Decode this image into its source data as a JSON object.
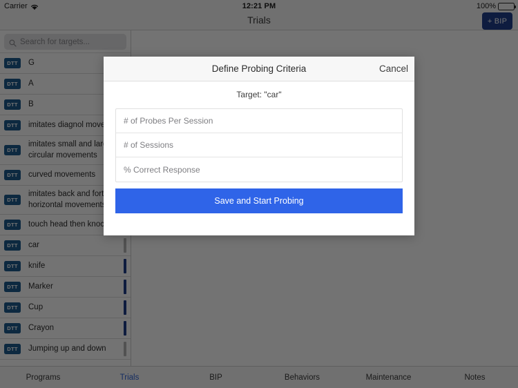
{
  "status_bar": {
    "carrier": "Carrier",
    "wifi_icon": "wifi-icon",
    "time": "12:21 PM",
    "battery_percent": "100%",
    "battery_icon": "battery-icon"
  },
  "nav_bar": {
    "title": "Trials",
    "bip_button_label": "+ BIP"
  },
  "sidebar": {
    "search": {
      "placeholder": "Search for targets...",
      "value": "",
      "icon": "search-icon"
    },
    "targets": [
      {
        "badge": "DTT",
        "label": "G",
        "accent": "none"
      },
      {
        "badge": "DTT",
        "label": "A",
        "accent": "none"
      },
      {
        "badge": "DTT",
        "label": "B",
        "accent": "none"
      },
      {
        "badge": "DTT",
        "label": "imitates diagnol movem",
        "accent": "none"
      },
      {
        "badge": "DTT",
        "label": "imitates small and large\ncircular movements",
        "accent": "none"
      },
      {
        "badge": "DTT",
        "label": "curved movements",
        "accent": "none"
      },
      {
        "badge": "DTT",
        "label": "imitates back and forth\nhorizontal movements",
        "accent": "none"
      },
      {
        "badge": "DTT",
        "label": "touch head then knock",
        "accent": "none"
      },
      {
        "badge": "DTT",
        "label": "car",
        "accent": "muted"
      },
      {
        "badge": "DTT",
        "label": "knife",
        "accent": "blue"
      },
      {
        "badge": "DTT",
        "label": "Marker",
        "accent": "blue"
      },
      {
        "badge": "DTT",
        "label": "Cup",
        "accent": "blue"
      },
      {
        "badge": "DTT",
        "label": "Crayon",
        "accent": "blue"
      },
      {
        "badge": "DTT",
        "label": "Jumping up and down",
        "accent": "muted"
      }
    ]
  },
  "modal": {
    "title": "Define Probing Criteria",
    "cancel_label": "Cancel",
    "subtitle": "Target: \"car\"",
    "fields": [
      {
        "placeholder": "# of Probes Per Session",
        "value": ""
      },
      {
        "placeholder": "# of Sessions",
        "value": ""
      },
      {
        "placeholder": "% Correct Response",
        "value": ""
      }
    ],
    "primary_button_label": "Save and Start Probing",
    "primary_button_color": "#2f64e8"
  },
  "tab_bar": {
    "active_color": "#2f64d8",
    "tabs": [
      {
        "label": "Programs",
        "active": false
      },
      {
        "label": "Trials",
        "active": true
      },
      {
        "label": "BIP",
        "active": false
      },
      {
        "label": "Behaviors",
        "active": false
      },
      {
        "label": "Maintenance",
        "active": false
      },
      {
        "label": "Notes",
        "active": false
      }
    ]
  }
}
